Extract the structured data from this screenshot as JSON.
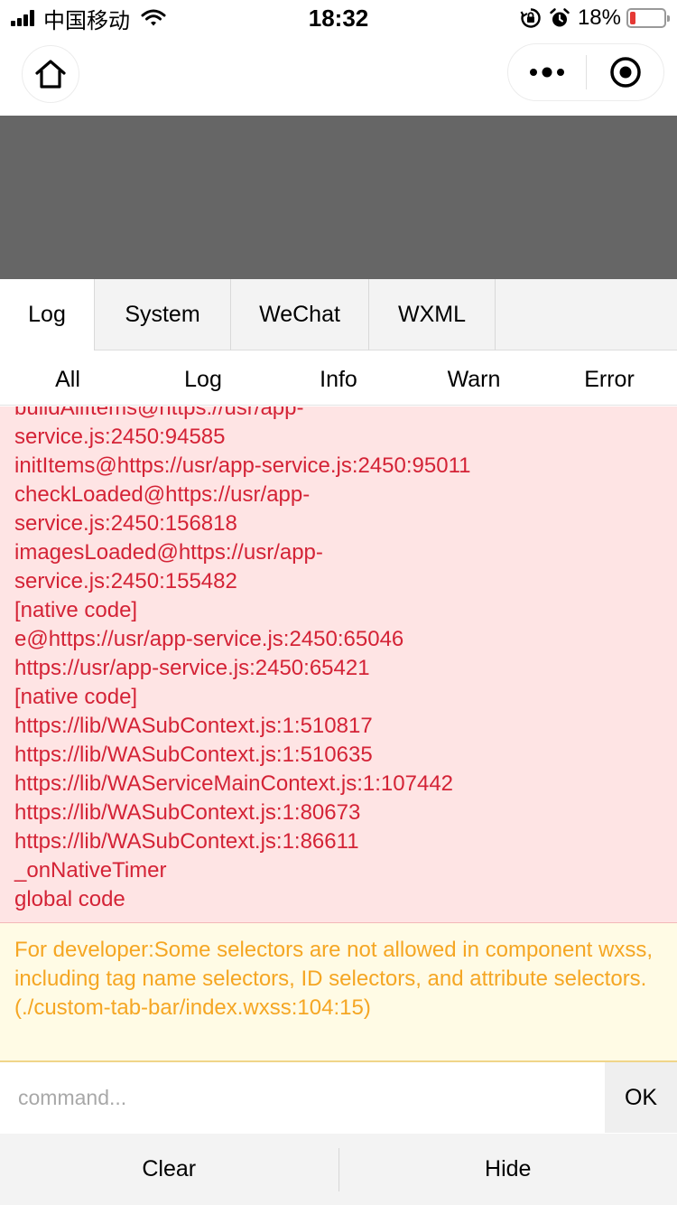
{
  "status_bar": {
    "carrier": "中国移动",
    "time": "18:32",
    "battery": "18%",
    "battery_level": 0.18,
    "icons": [
      "signal-icon",
      "wifi-icon",
      "rotation-lock-icon",
      "alarm-icon",
      "battery-icon"
    ]
  },
  "nav": {
    "icons": [
      "home-icon",
      "more-dots-icon",
      "close-target-icon"
    ]
  },
  "tabs": [
    {
      "label": "Log",
      "active": true
    },
    {
      "label": "System",
      "active": false
    },
    {
      "label": "WeChat",
      "active": false
    },
    {
      "label": "WXML",
      "active": false
    }
  ],
  "filters": [
    {
      "label": "All"
    },
    {
      "label": "Log"
    },
    {
      "label": "Info"
    },
    {
      "label": "Warn"
    },
    {
      "label": "Error"
    }
  ],
  "error_log": {
    "color": "#d42336",
    "lines": [
      "buildAllItems@https://usr/app-",
      "service.js:2450:94585",
      "initItems@https://usr/app-service.js:2450:95011",
      "checkLoaded@https://usr/app-",
      "service.js:2450:156818",
      "imagesLoaded@https://usr/app-",
      "service.js:2450:155482",
      "[native code]",
      "e@https://usr/app-service.js:2450:65046",
      "https://usr/app-service.js:2450:65421",
      "[native code]",
      "https://lib/WASubContext.js:1:510817",
      "https://lib/WASubContext.js:1:510635",
      "https://lib/WAServiceMainContext.js:1:107442",
      "https://lib/WASubContext.js:1:80673",
      "https://lib/WASubContext.js:1:86611",
      "_onNativeTimer",
      "global code"
    ]
  },
  "warn_log": {
    "color": "#f5a623",
    "text": "For developer:Some selectors are not allowed in component wxss, including tag name selectors, ID selectors, and attribute selectors.(./custom-tab-bar/index.wxss:104:15)"
  },
  "command": {
    "placeholder": "command...",
    "value": "",
    "ok_label": "OK"
  },
  "bottom": {
    "clear_label": "Clear",
    "hide_label": "Hide"
  }
}
